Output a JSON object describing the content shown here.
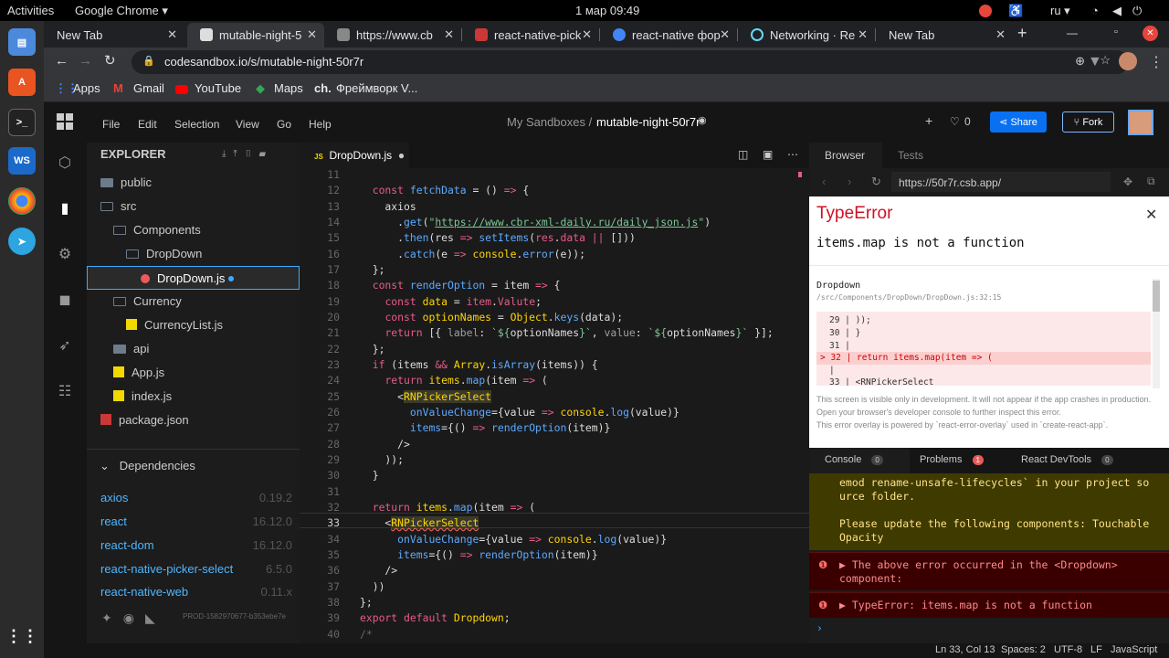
{
  "system": {
    "activities": "Activities",
    "app_menu": "Google Chrome ▾",
    "clock": "1 мар  09:49",
    "lang": "ru ▾"
  },
  "browser_tabs": [
    {
      "title": "New Tab"
    },
    {
      "title": "mutable-night-5"
    },
    {
      "title": "https://www.cb"
    },
    {
      "title": "react-native-pick"
    },
    {
      "title": "react-native фор"
    },
    {
      "title": "Networking · Re"
    },
    {
      "title": "New Tab"
    }
  ],
  "omnibox": {
    "url": "codesandbox.io/s/mutable-night-50r7r"
  },
  "bookmarks": [
    "Apps",
    "Gmail",
    "YouTube",
    "Maps",
    "Фреймворк V..."
  ],
  "csb": {
    "menu": [
      "File",
      "Edit",
      "Selection",
      "View",
      "Go",
      "Help"
    ],
    "breadcrumb": "My Sandboxes /",
    "sandbox_name": "mutable-night-50r7r",
    "likes": "0",
    "share": "Share",
    "fork": "Fork"
  },
  "explorer": {
    "title": "EXPLORER",
    "tree": [
      "public",
      "src",
      "Components",
      "DropDown",
      "DropDown.js",
      "Currency",
      "CurrencyList.js",
      "api",
      "App.js",
      "index.js",
      "package.json"
    ],
    "deps_title": "Dependencies",
    "deps": [
      {
        "name": "axios",
        "ver": "0.19.2"
      },
      {
        "name": "react",
        "ver": "16.12.0"
      },
      {
        "name": "react-dom",
        "ver": "16.12.0"
      },
      {
        "name": "react-native-picker-select",
        "ver": "6.5.0"
      },
      {
        "name": "react-native-web",
        "ver": "0.11.x"
      }
    ],
    "build": "PROD-1582970677-b353ebe7e"
  },
  "editor": {
    "tab": "DropDown.js",
    "lines": [
      "11",
      "12",
      "13",
      "14",
      "15",
      "16",
      "17",
      "18",
      "19",
      "20",
      "21",
      "22",
      "23",
      "24",
      "25",
      "26",
      "27",
      "28",
      "29",
      "30",
      "31",
      "32",
      "33",
      "34",
      "35",
      "36",
      "37",
      "38",
      "39",
      "40"
    ]
  },
  "preview": {
    "tab_browser": "Browser",
    "tab_tests": "Tests",
    "url": "https://50r7r.csb.app/",
    "error_title": "TypeError",
    "error_msg": "items.map is not a function",
    "trace_fn": "Dropdown",
    "trace_path": "/src/Components/DropDown/DropDown.js:32:15",
    "trace_lines": [
      "29 |     ));",
      "30 |   }",
      "31 |",
      "> 32 |   return items.map(item => (",
      "     |",
      "33 |     <RNPickerSelect"
    ],
    "note1": "This screen is visible only in development. It will not appear if the app crashes in production.",
    "note2": "Open your browser's developer console to further inspect this error.",
    "note3": "This error overlay is powered by `react-error-overlay` used in `create-react-app`.",
    "console_tab": "Console",
    "console_count": "0",
    "problems_tab": "Problems",
    "problems_count": "1",
    "devtools_tab": "React DevTools",
    "devtools_count": "0",
    "console_warn": "emod rename-unsafe-lifecycles` in your project so urce folder.",
    "console_warn2": "Please update the following components: Touchable Opacity",
    "console_err1": "▶ The above error occurred in the <Dropdown> component:",
    "console_err2": "▶ TypeError: items.map is not a function",
    "prompt": "›"
  },
  "status": {
    "pos": "Ln 33, Col 13",
    "spaces": "Spaces: 2",
    "enc": "UTF-8",
    "eol": "LF",
    "lang": "JavaScript"
  }
}
